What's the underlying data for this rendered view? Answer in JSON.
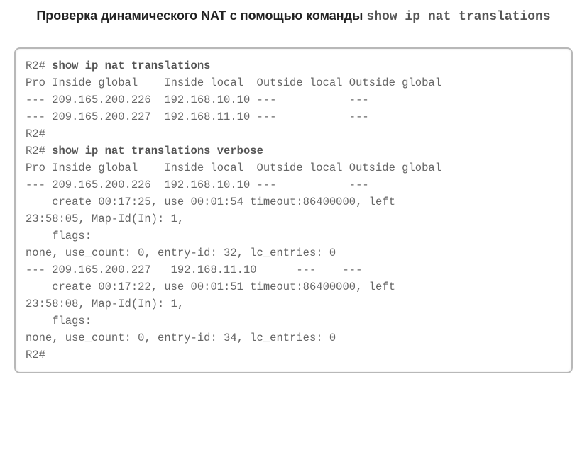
{
  "title": {
    "text_part": "Проверка динамического NAT с помощью команды",
    "mono_part": "show ip nat translations"
  },
  "terminal": {
    "lines": [
      {
        "prompt": "R2# ",
        "cmd": "show ip nat translations"
      },
      {
        "text": "Pro Inside global    Inside local  Outside local Outside global"
      },
      {
        "text": "--- 209.165.200.226  192.168.10.10 ---           ---"
      },
      {
        "text": "--- 209.165.200.227  192.168.11.10 ---           ---"
      },
      {
        "text": "R2#"
      },
      {
        "prompt": "R2# ",
        "cmd": "show ip nat translations verbose"
      },
      {
        "text": "Pro Inside global    Inside local  Outside local Outside global"
      },
      {
        "text": "--- 209.165.200.226  192.168.10.10 ---           ---"
      },
      {
        "text": "    create 00:17:25, use 00:01:54 timeout:86400000, left"
      },
      {
        "text": "23:58:05, Map-Id(In): 1,"
      },
      {
        "text": "    flags:"
      },
      {
        "text": "none, use_count: 0, entry-id: 32, lc_entries: 0"
      },
      {
        "text": "--- 209.165.200.227   192.168.11.10      ---    ---"
      },
      {
        "text": "    create 00:17:22, use 00:01:51 timeout:86400000, left"
      },
      {
        "text": "23:58:08, Map-Id(In): 1,"
      },
      {
        "text": "    flags:"
      },
      {
        "text": "none, use_count: 0, entry-id: 34, lc_entries: 0"
      },
      {
        "text": "R2#"
      }
    ]
  }
}
